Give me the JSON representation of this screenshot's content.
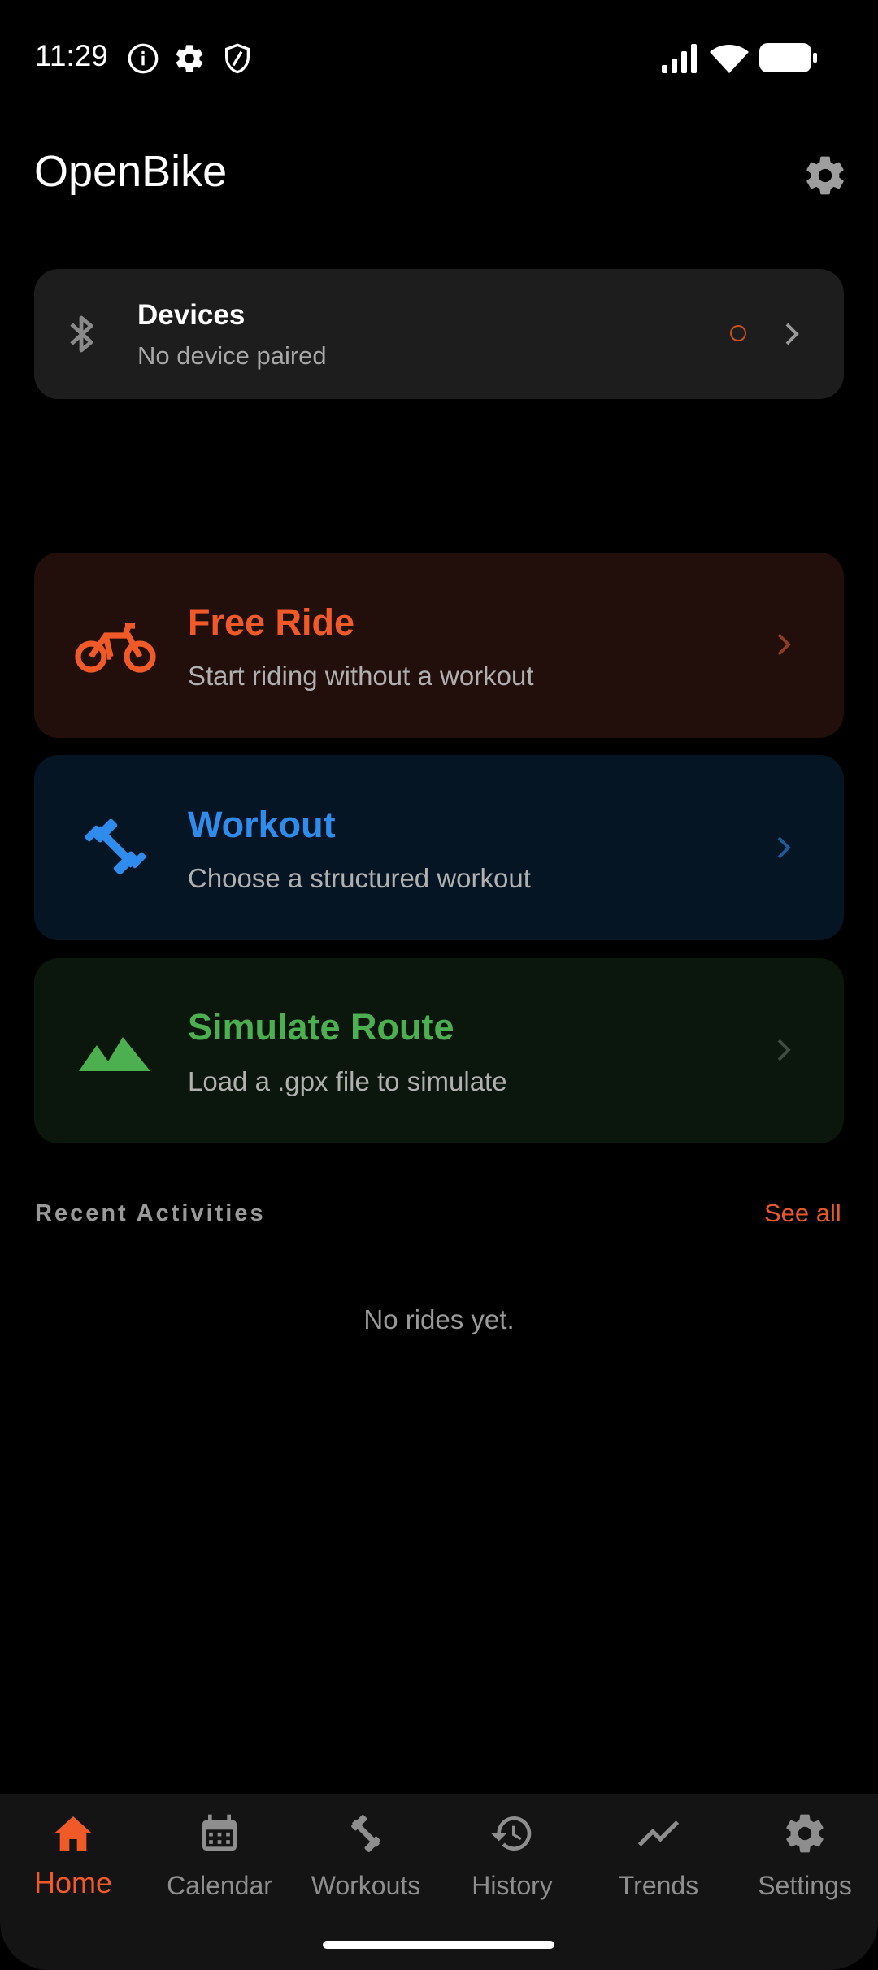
{
  "status_bar": {
    "time": "11:29"
  },
  "app": {
    "title": "OpenBike"
  },
  "devices": {
    "title": "Devices",
    "subtitle": "No device paired"
  },
  "actions": [
    {
      "title": "Free Ride",
      "subtitle": "Start riding without a workout",
      "accent": "#f05a28",
      "bg": "#220f0b",
      "icon": "bike-icon"
    },
    {
      "title": "Workout",
      "subtitle": "Choose a structured workout",
      "accent": "#2f8cec",
      "bg": "#061523",
      "icon": "dumbbell-icon"
    },
    {
      "title": "Simulate Route",
      "subtitle": "Load a .gpx file to simulate",
      "accent": "#4caf50",
      "bg": "#0b160d",
      "icon": "mountain-icon"
    }
  ],
  "recent": {
    "label": "Recent Activities",
    "see_all": "See all",
    "empty": "No rides yet."
  },
  "nav": [
    {
      "label": "Home",
      "icon": "home-icon",
      "active": true
    },
    {
      "label": "Calendar",
      "icon": "calendar-icon"
    },
    {
      "label": "Workouts",
      "icon": "dumbbell-icon"
    },
    {
      "label": "History",
      "icon": "history-icon"
    },
    {
      "label": "Trends",
      "icon": "trend-icon"
    },
    {
      "label": "Settings",
      "icon": "gear-icon"
    }
  ],
  "colors": {
    "accent": "#ef5a28",
    "card": "#1d1d1d",
    "nav_bg": "#141414"
  }
}
